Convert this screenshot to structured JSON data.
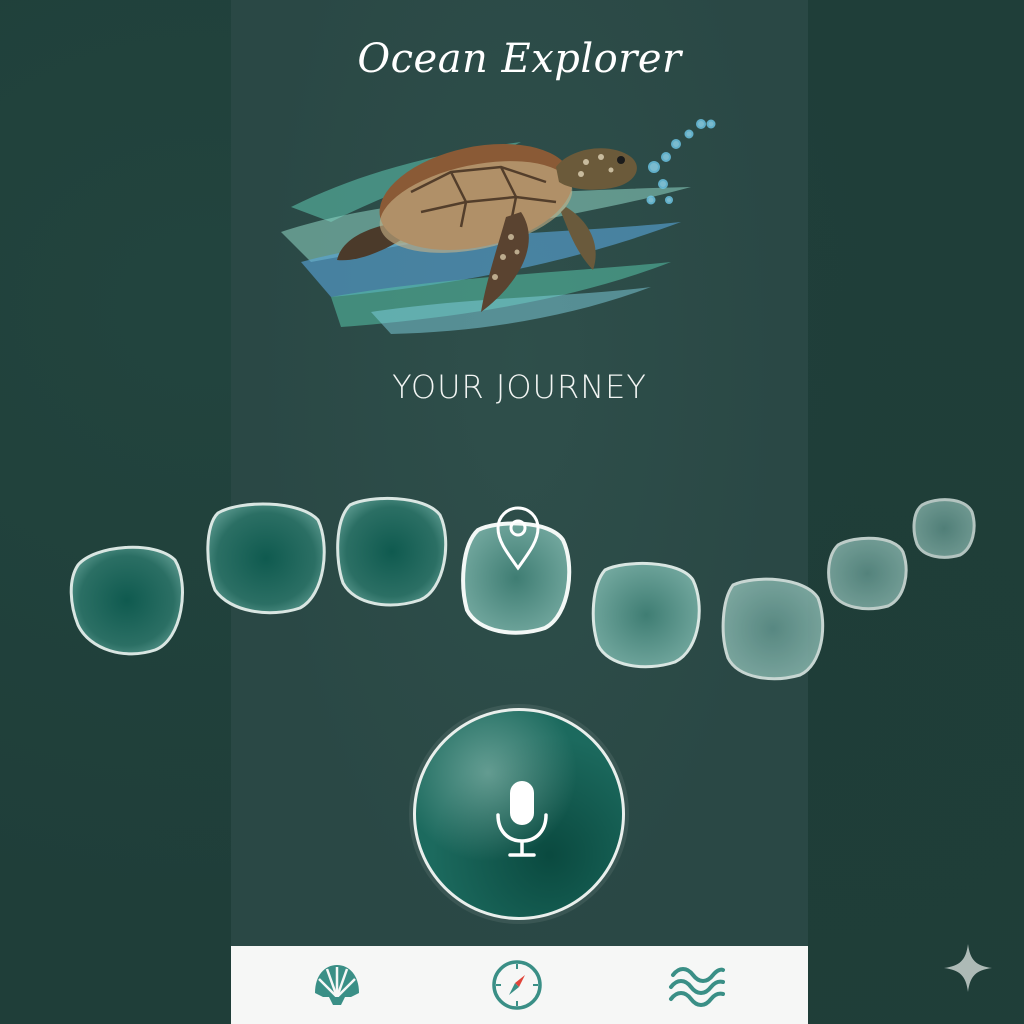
{
  "app": {
    "title": "Ocean Explorer"
  },
  "journey": {
    "heading": "YOUR JOURNEY",
    "stones": [
      {
        "id": 1,
        "state": "completed"
      },
      {
        "id": 2,
        "state": "completed"
      },
      {
        "id": 3,
        "state": "completed"
      },
      {
        "id": 4,
        "state": "current"
      },
      {
        "id": 5,
        "state": "upcoming"
      },
      {
        "id": 6,
        "state": "upcoming"
      },
      {
        "id": 7,
        "state": "locked"
      },
      {
        "id": 8,
        "state": "locked"
      }
    ]
  },
  "hero": {
    "icon": "sea-turtle-illustration"
  },
  "voice": {
    "icon": "microphone-icon"
  },
  "tabbar": {
    "tabs": [
      {
        "icon": "shell-icon"
      },
      {
        "icon": "compass-icon"
      },
      {
        "icon": "waves-icon"
      }
    ]
  },
  "colors": {
    "background": "#1f3e39",
    "panel": "#2a4845",
    "accent": "#1c6a5e",
    "stone_dark": "#1d5e55",
    "stone_light": "#6fa39a",
    "tabbar": "#f6f7f6"
  }
}
